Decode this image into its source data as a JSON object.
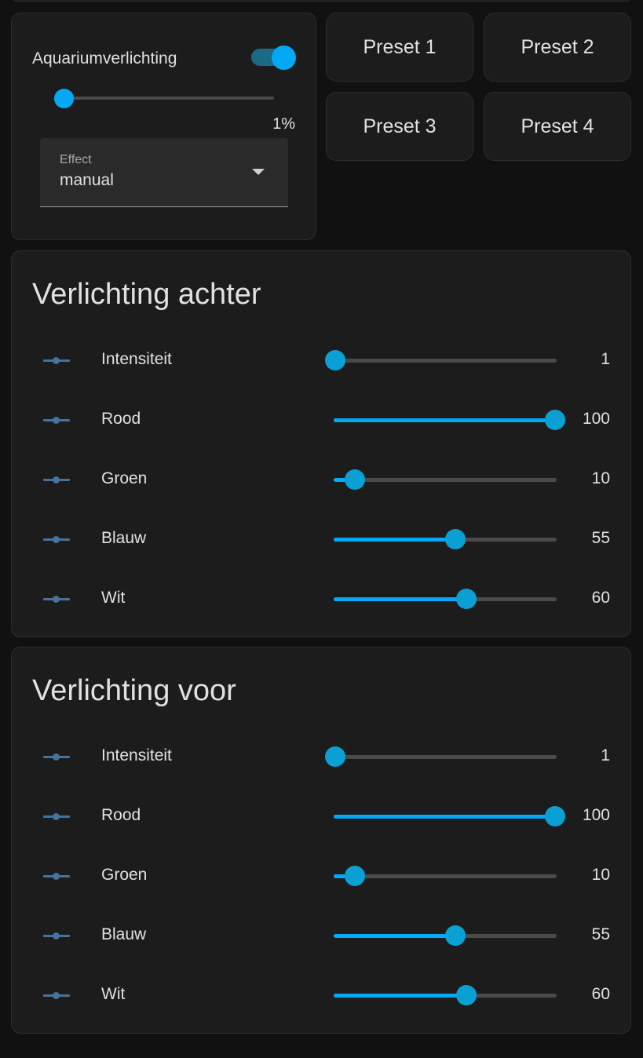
{
  "light_card": {
    "name": "Aquariumverlichting",
    "toggle_on": true,
    "brightness_percent": 1,
    "brightness_label": "1%",
    "effect_label": "Effect",
    "effect_value": "manual"
  },
  "presets": [
    {
      "label": "Preset 1"
    },
    {
      "label": "Preset 2"
    },
    {
      "label": "Preset 3"
    },
    {
      "label": "Preset 4"
    }
  ],
  "sections": [
    {
      "title": "Verlichting achter",
      "rows": [
        {
          "label": "Intensiteit",
          "value": "1",
          "level": 1
        },
        {
          "label": "Rood",
          "value": "100",
          "level": 100
        },
        {
          "label": "Groen",
          "value": "10",
          "level": 10
        },
        {
          "label": "Blauw",
          "value": "55",
          "level": 55
        },
        {
          "label": "Wit",
          "value": "60",
          "level": 60
        }
      ]
    },
    {
      "title": "Verlichting voor",
      "rows": [
        {
          "label": "Intensiteit",
          "value": "1",
          "level": 1
        },
        {
          "label": "Rood",
          "value": "100",
          "level": 100
        },
        {
          "label": "Groen",
          "value": "10",
          "level": 10
        },
        {
          "label": "Blauw",
          "value": "55",
          "level": 55
        },
        {
          "label": "Wit",
          "value": "60",
          "level": 60
        }
      ]
    }
  ],
  "colors": {
    "accent": "#03a9f4",
    "icon": "#44739e",
    "card": "#1c1c1c",
    "background": "#111111"
  },
  "icons": {
    "row_icon": "tune-slider-icon",
    "dropdown": "chevron-down-icon"
  }
}
